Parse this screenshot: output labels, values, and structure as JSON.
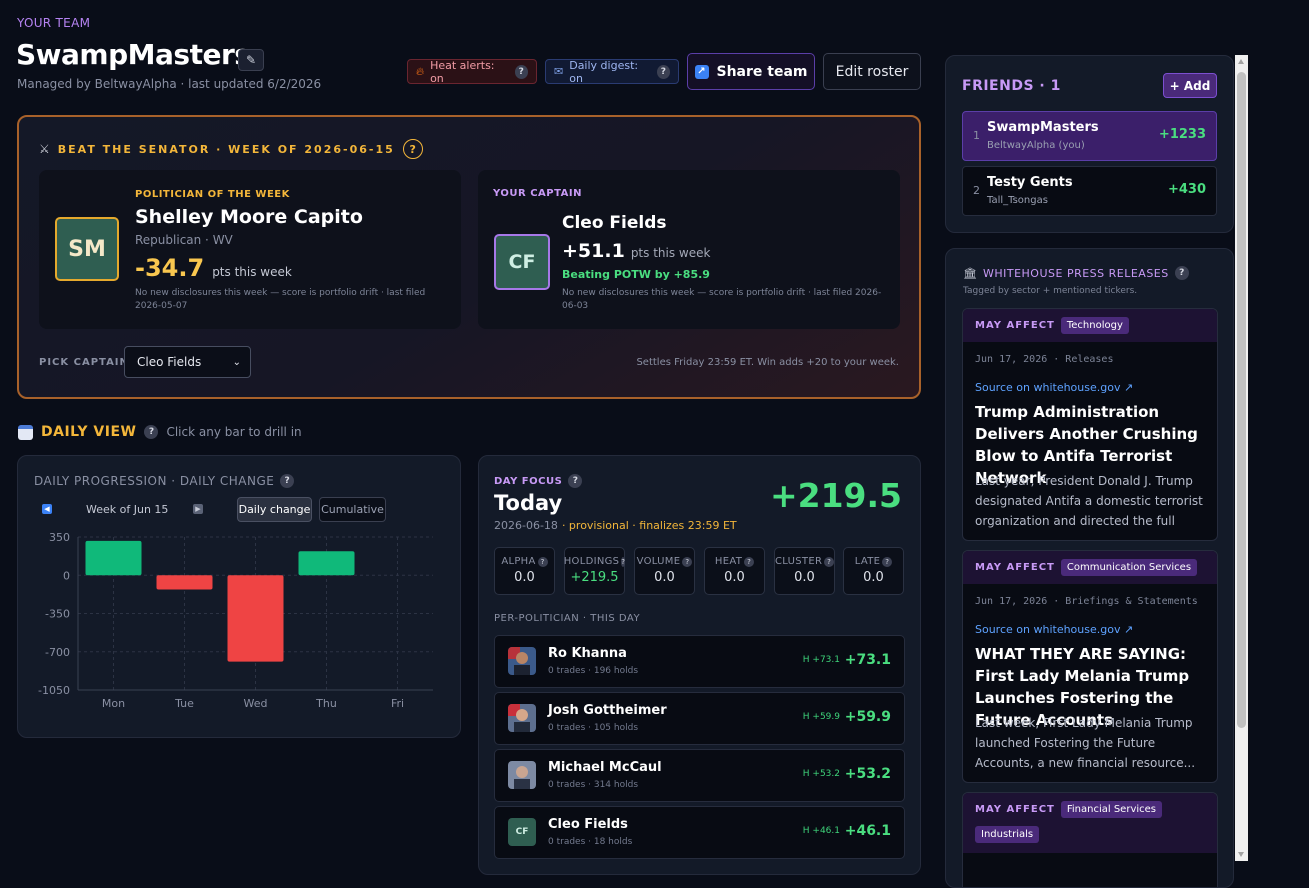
{
  "header": {
    "eyebrow": "YOUR TEAM",
    "team_name": "SwampMasters",
    "managed": "Managed by BeltwayAlpha · last updated 6/2/2026",
    "heat_alerts": "Heat alerts: on",
    "daily_digest": "Daily digest: on",
    "share_label": "Share team",
    "edit_label": "Edit roster"
  },
  "beat": {
    "title": "BEAT THE SENATOR · WEEK OF 2026-06-15",
    "potw_label": "POLITICIAN OF THE WEEK",
    "potw_initials": "SM",
    "potw_name": "Shelley Moore Capito",
    "potw_party": "Republican · WV",
    "potw_score": "-34.7",
    "pts_label": "pts this week",
    "potw_note": "No new disclosures this week — score is portfolio drift · last filed 2026-05-07",
    "captain_label": "YOUR CAPTAIN",
    "captain_initials": "CF",
    "captain_name": "Cleo Fields",
    "captain_score": "+51.1",
    "captain_beating": "Beating POTW by +85.9",
    "captain_note": "No new disclosures this week — score is portfolio drift · last filed 2026-06-03",
    "pick_label": "PICK CAPTAIN:",
    "pick_value": "Cleo Fields",
    "settles": "Settles Friday 23:59 ET. Win adds +20 to your week."
  },
  "daily": {
    "title": "DAILY VIEW",
    "hint": "Click any bar to drill in",
    "chart_title": "DAILY PROGRESSION · DAILY CHANGE",
    "week_label": "Week of Jun 15",
    "tab_daily": "Daily change",
    "tab_cumulative": "Cumulative"
  },
  "chart_data": {
    "type": "bar",
    "categories": [
      "Mon",
      "Tue",
      "Wed",
      "Thu",
      "Fri"
    ],
    "values": [
      314,
      -130,
      -790,
      219.5,
      null
    ],
    "ylim": [
      -1050,
      350
    ],
    "yticks": [
      350,
      0,
      -350,
      -700,
      -1050
    ],
    "grid": true,
    "colors": {
      "positive": "#10b97a",
      "negative": "#ef4444"
    }
  },
  "focus": {
    "label": "DAY FOCUS",
    "day": "Today",
    "total": "+219.5",
    "date": "2026-06-18",
    "status": "· provisional · finalizes 23:59 ET",
    "metrics": [
      {
        "label": "ALPHA",
        "value": "0.0"
      },
      {
        "label": "HOLDINGS",
        "value": "+219.5"
      },
      {
        "label": "VOLUME",
        "value": "0.0"
      },
      {
        "label": "HEAT",
        "value": "0.0"
      },
      {
        "label": "CLUSTER",
        "value": "0.0"
      },
      {
        "label": "LATE",
        "value": "0.0"
      }
    ],
    "per_label": "PER-POLITICIAN · THIS DAY",
    "politicians": [
      {
        "name": "Ro Khanna",
        "sub": "0 trades · 196 holds",
        "h": "H +73.1",
        "value": "+73.1",
        "initials": ""
      },
      {
        "name": "Josh Gottheimer",
        "sub": "0 trades · 105 holds",
        "h": "H +59.9",
        "value": "+59.9",
        "initials": ""
      },
      {
        "name": "Michael McCaul",
        "sub": "0 trades · 314 holds",
        "h": "H +53.2",
        "value": "+53.2",
        "initials": ""
      },
      {
        "name": "Cleo Fields",
        "sub": "0 trades · 18 holds",
        "h": "H +46.1",
        "value": "+46.1",
        "initials": "CF"
      }
    ]
  },
  "friends": {
    "title": "FRIENDS · 1",
    "add_label": "+ Add",
    "rows": [
      {
        "rank": "1",
        "name": "SwampMasters",
        "user": "BeltwayAlpha (you)",
        "score": "+1233"
      },
      {
        "rank": "2",
        "name": "Testy Gents",
        "user": "Tall_Tsongas",
        "score": "+430"
      }
    ]
  },
  "press": {
    "title": "WHITEHOUSE PRESS RELEASES",
    "subtitle": "Tagged by sector + mentioned tickers.",
    "may_affect": "MAY AFFECT",
    "items": [
      {
        "sector": "Technology",
        "date": "Jun 17, 2026 · Releases",
        "source": "Source on whitehouse.gov ↗",
        "title": "Trump Administration Delivers Another Crushing Blow to Antifa Terrorist Network",
        "body": "Last year, President Donald J. Trump designated Antifa a domestic terrorist organization and directed the full power ..."
      },
      {
        "sector": "Communication Services",
        "date": "Jun 17, 2026 · Briefings & Statements",
        "source": "Source on whitehouse.gov ↗",
        "title": "WHAT THEY ARE SAYING: First Lady Melania Trump Launches Fostering the Future Accounts",
        "body": "Last week, First Lady Melania Trump launched Fostering the Future Accounts, a new financial resource..."
      },
      {
        "sector": "Financial Services",
        "sector2": "Industrials"
      }
    ]
  }
}
